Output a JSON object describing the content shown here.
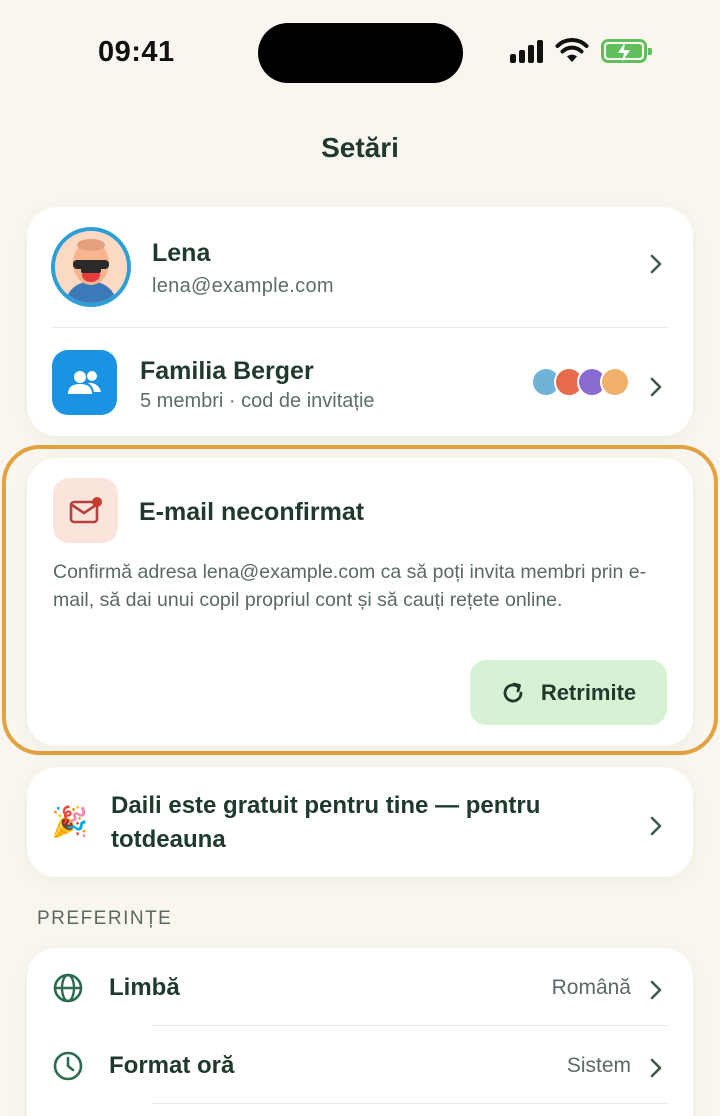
{
  "status_bar": {
    "time": "09:41"
  },
  "header": {
    "title": "Setări"
  },
  "account": {
    "name": "Lena",
    "email": "lena@example.com"
  },
  "family": {
    "name": "Familia Berger",
    "subtitle": "5 membri · cod de invitație"
  },
  "email_warning": {
    "title": "E-mail neconfirmat",
    "description": "Confirmă adresa lena@example.com ca să poți invita membri prin e-mail, să dai unui copil propriul cont și să cauți rețete online.",
    "resend_label": "Retrimite"
  },
  "promo": {
    "text": "Daili este gratuit pentru tine — pentru totdeauna"
  },
  "preferences": {
    "section_label": "PREFERINȚE",
    "items": [
      {
        "label": "Limbă",
        "value": "Română",
        "icon": "globe-icon"
      },
      {
        "label": "Format oră",
        "value": "Sistem",
        "icon": "clock-icon"
      }
    ]
  },
  "colors": {
    "background": "#f8f6ee",
    "accent_blue": "#1993e2",
    "warning_outline": "#e2a23e",
    "resend_bg": "#d6f2d4",
    "text_dark": "#1f3a2c"
  }
}
